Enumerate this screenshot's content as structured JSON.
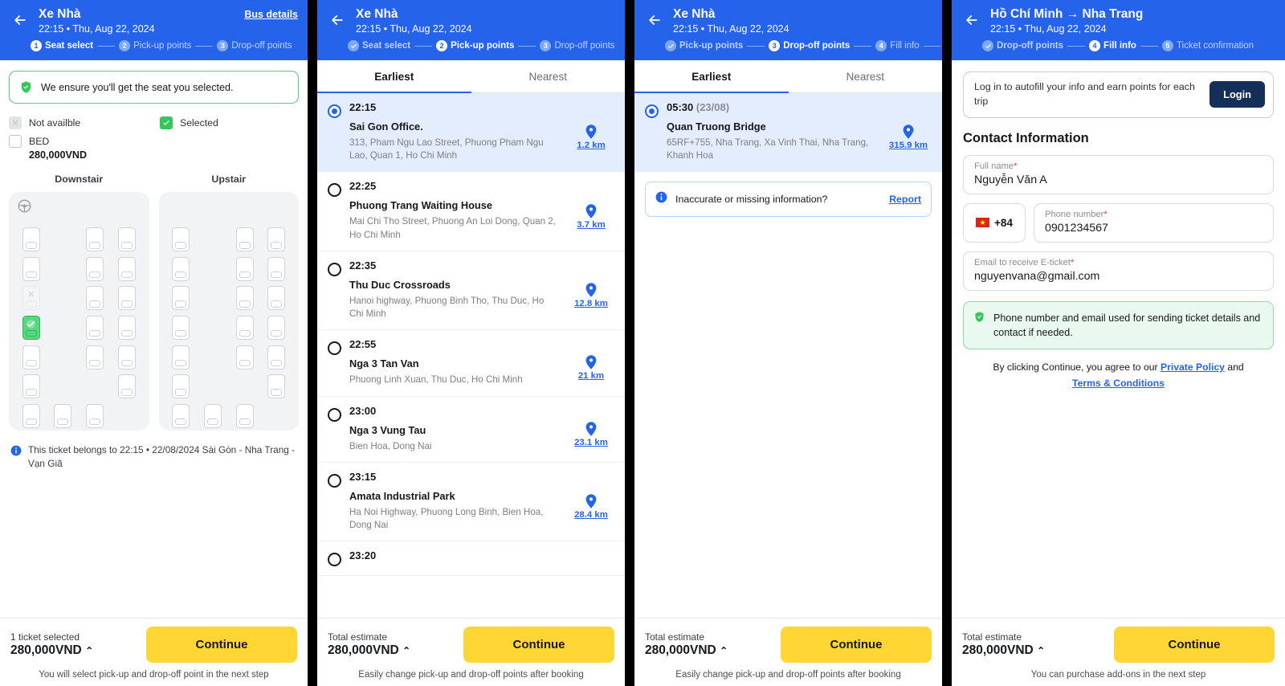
{
  "colors": {
    "brand_blue": "#2563EB",
    "accent_yellow": "#FFD633",
    "success_green": "#34C759",
    "login_navy": "#142F58"
  },
  "panel1": {
    "header": {
      "title": "Xe Nhà",
      "subtitle": "22:15 • Thu, Aug 22, 2024",
      "link": "Bus details",
      "back_icon": "back-arrow-icon"
    },
    "steps": [
      {
        "num": "1",
        "label": "Seat select",
        "state": "active"
      },
      {
        "num": "2",
        "label": "Pick-up points",
        "state": "todo"
      },
      {
        "num": "3",
        "label": "Drop-off points",
        "state": "todo"
      }
    ],
    "ensure_text": "We ensure you'll get the seat you selected.",
    "legend": {
      "not_available": "Not availble",
      "selected": "Selected",
      "bed_label": "BED",
      "bed_price": "280,000VND"
    },
    "decks": [
      {
        "title": "Downstair"
      },
      {
        "title": "Upstair"
      }
    ],
    "seat_map": {
      "rows": 7,
      "cols": 4,
      "driver_icon": "steering-wheel-icon",
      "downstair": [
        [
          "seat",
          "empty",
          "seat",
          "seat"
        ],
        [
          "seat",
          "empty",
          "seat",
          "seat"
        ],
        [
          "unavailable",
          "empty",
          "seat",
          "seat"
        ],
        [
          "selected",
          "empty",
          "seat",
          "seat"
        ],
        [
          "seat",
          "empty",
          "seat",
          "seat"
        ],
        [
          "seat",
          "empty",
          "empty",
          "seat"
        ],
        [
          "seat",
          "seat",
          "seat",
          "empty"
        ]
      ],
      "upstair": [
        [
          "seat",
          "empty",
          "seat",
          "seat"
        ],
        [
          "seat",
          "empty",
          "seat",
          "seat"
        ],
        [
          "seat",
          "empty",
          "seat",
          "seat"
        ],
        [
          "seat",
          "empty",
          "seat",
          "seat"
        ],
        [
          "seat",
          "empty",
          "seat",
          "seat"
        ],
        [
          "seat",
          "empty",
          "empty",
          "seat"
        ],
        [
          "seat",
          "seat",
          "seat",
          "empty"
        ]
      ]
    },
    "ticket_note": "This ticket belongs to 22:15 • 22/08/2024 Sài Gòn - Nha Trang - Vạn Giã",
    "footer": {
      "total_label": "1 ticket selected",
      "price": "280,000VND",
      "caret": "⌃",
      "continue": "Continue",
      "note": "You will select pick-up and drop-off point in the next step"
    }
  },
  "panel2": {
    "header": {
      "title": "Xe Nhà",
      "subtitle": "22:15 • Thu, Aug 22, 2024",
      "back_icon": "back-arrow-icon"
    },
    "steps": [
      {
        "num": "✓",
        "label": "Seat select",
        "state": "done"
      },
      {
        "num": "2",
        "label": "Pick-up points",
        "state": "active"
      },
      {
        "num": "3",
        "label": "Drop-off points",
        "state": "todo"
      }
    ],
    "tabs": [
      {
        "label": "Earliest",
        "active": true
      },
      {
        "label": "Nearest",
        "active": false
      }
    ],
    "points": [
      {
        "time": "22:15",
        "date": "",
        "name": "Sai Gon Office.",
        "address": "313, Pham Ngu Lao Street, Phuong Pham Ngu Lao, Quan 1, Ho Chi Minh",
        "distance": "1.2 km",
        "selected": true
      },
      {
        "time": "22:25",
        "date": "",
        "name": "Phuong Trang Waiting House",
        "address": "Mai Chi Tho Street, Phuong An Loi Dong, Quan 2, Ho Chi Minh",
        "distance": "3.7 km",
        "selected": false
      },
      {
        "time": "22:35",
        "date": "",
        "name": "Thu Duc Crossroads",
        "address": "Hanoi highway, Phuong Binh Tho, Thu Duc, Ho Chi Minh",
        "distance": "12.8 km",
        "selected": false
      },
      {
        "time": "22:55",
        "date": "",
        "name": "Nga 3 Tan Van",
        "address": "Phuong Linh Xuan, Thu Duc, Ho Chi Minh",
        "distance": "21 km",
        "selected": false
      },
      {
        "time": "23:00",
        "date": "",
        "name": "Nga 3 Vung Tau",
        "address": "Bien Hoa, Dong Nai",
        "distance": "23.1 km",
        "selected": false
      },
      {
        "time": "23:15",
        "date": "",
        "name": "Amata Industrial Park",
        "address": "Ha Noi Highway, Phuong Long Binh, Bien Hoa, Dong Nai",
        "distance": "28.4 km",
        "selected": false
      },
      {
        "time": "23:20",
        "date": "",
        "name": "",
        "address": "",
        "distance": "",
        "selected": false
      }
    ],
    "footer": {
      "total_label": "Total estimate",
      "price": "280,000VND",
      "caret": "⌃",
      "continue": "Continue",
      "note": "Easily change pick-up and drop-off points after booking"
    }
  },
  "panel3": {
    "header": {
      "title": "Xe Nhà",
      "subtitle": "22:15 • Thu, Aug 22, 2024",
      "back_icon": "back-arrow-icon"
    },
    "steps": [
      {
        "num": "✓",
        "label": "Pick-up points",
        "state": "done"
      },
      {
        "num": "3",
        "label": "Drop-off points",
        "state": "active"
      },
      {
        "num": "4",
        "label": "Fill info",
        "state": "todo"
      }
    ],
    "tabs": [
      {
        "label": "Earliest",
        "active": true
      },
      {
        "label": "Nearest",
        "active": false
      }
    ],
    "points": [
      {
        "time": "05:30",
        "date": "(23/08)",
        "name": "Quan Truong Bridge",
        "address": "65RF+755, Nha Trang, Xa Vinh Thai, Nha Trang, Khanh Hoa",
        "distance": "315.9 km",
        "selected": true
      }
    ],
    "report": {
      "text": "Inaccurate or missing information?",
      "link": "Report"
    },
    "footer": {
      "total_label": "Total estimate",
      "price": "280,000VND",
      "caret": "⌃",
      "continue": "Continue",
      "note": "Easily change pick-up and drop-off points after booking"
    }
  },
  "panel4": {
    "header": {
      "title": "Hồ Chí Minh → Nha Trang",
      "subtitle": "22:15 • Thu, Aug 22, 2024",
      "back_icon": "back-arrow-icon"
    },
    "steps": [
      {
        "num": "✓",
        "label": "Drop-off points",
        "state": "done"
      },
      {
        "num": "4",
        "label": "Fill info",
        "state": "active"
      },
      {
        "num": "5",
        "label": "Ticket confirmation",
        "state": "todo"
      }
    ],
    "login": {
      "text": "Log in to autofill your info and earn points for each trip",
      "button": "Login"
    },
    "section_title": "Contact Information",
    "fields": {
      "full_name": {
        "label": "Full name",
        "required": "*",
        "value": "Nguyễn Văn A"
      },
      "country_code": {
        "value": "+84",
        "flag": "vietnam-flag-icon"
      },
      "phone": {
        "label": "Phone number",
        "required": "*",
        "value": "0901234567"
      },
      "email": {
        "label": "Email to receive E-ticket",
        "required": "*",
        "value": "nguyenvana@gmail.com"
      }
    },
    "green_note": "Phone number and email used for sending ticket details and contact if needed.",
    "policy": {
      "prefix": "By clicking Continue, you agree to our ",
      "link1": "Private Policy",
      "middle": " and ",
      "link2": "Terms & Conditions"
    },
    "footer": {
      "total_label": "Total estimate",
      "price": "280,000VND",
      "caret": "⌃",
      "continue": "Continue",
      "note": "You can purchase add-ons in the next step"
    }
  }
}
